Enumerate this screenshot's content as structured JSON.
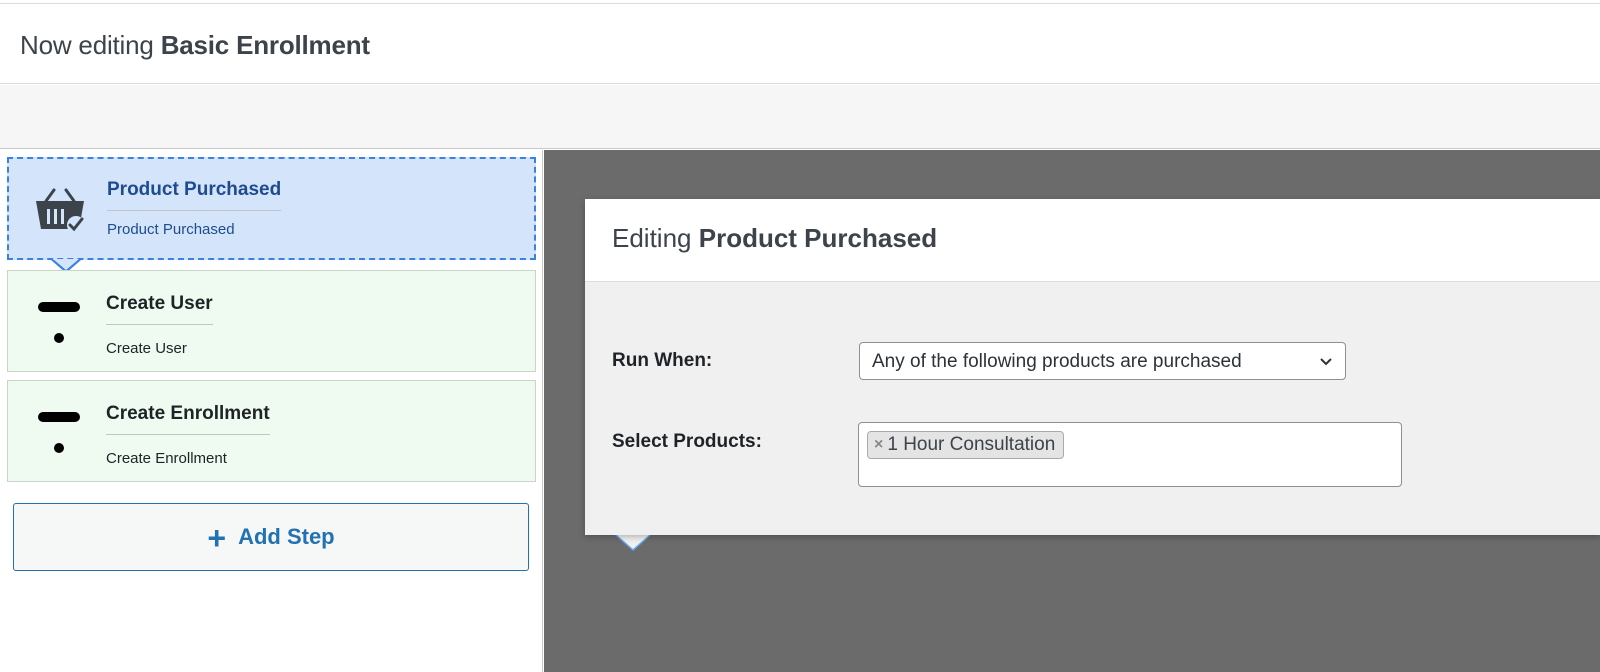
{
  "header": {
    "prefix": "Now editing",
    "name": "Basic Enrollment"
  },
  "steps": [
    {
      "title": "Product Purchased",
      "subtitle": "Product Purchased",
      "icon": "basket-check-icon",
      "active": true
    },
    {
      "title": "Create User",
      "subtitle": "Create User",
      "icon": "dash-dot-icon",
      "active": false
    },
    {
      "title": "Create Enrollment",
      "subtitle": "Create Enrollment",
      "icon": "dash-dot-icon",
      "active": false
    }
  ],
  "add_step": {
    "icon": "plus-icon",
    "label": "Add Step"
  },
  "editor": {
    "prefix": "Editing",
    "name": "Product Purchased",
    "run_when_label": "Run When:",
    "run_when_value": "Any of the following products are purchased",
    "select_products_label": "Select Products:",
    "selected_products": [
      "1 Hour Consultation"
    ],
    "remove_glyph": "×"
  },
  "colors": {
    "active_step_bg": "#d4e5fb",
    "active_step_border": "#3b82e0",
    "step_bg": "#effaf1",
    "accent": "#2271b1",
    "canvas_bg": "#6b6b6b"
  }
}
